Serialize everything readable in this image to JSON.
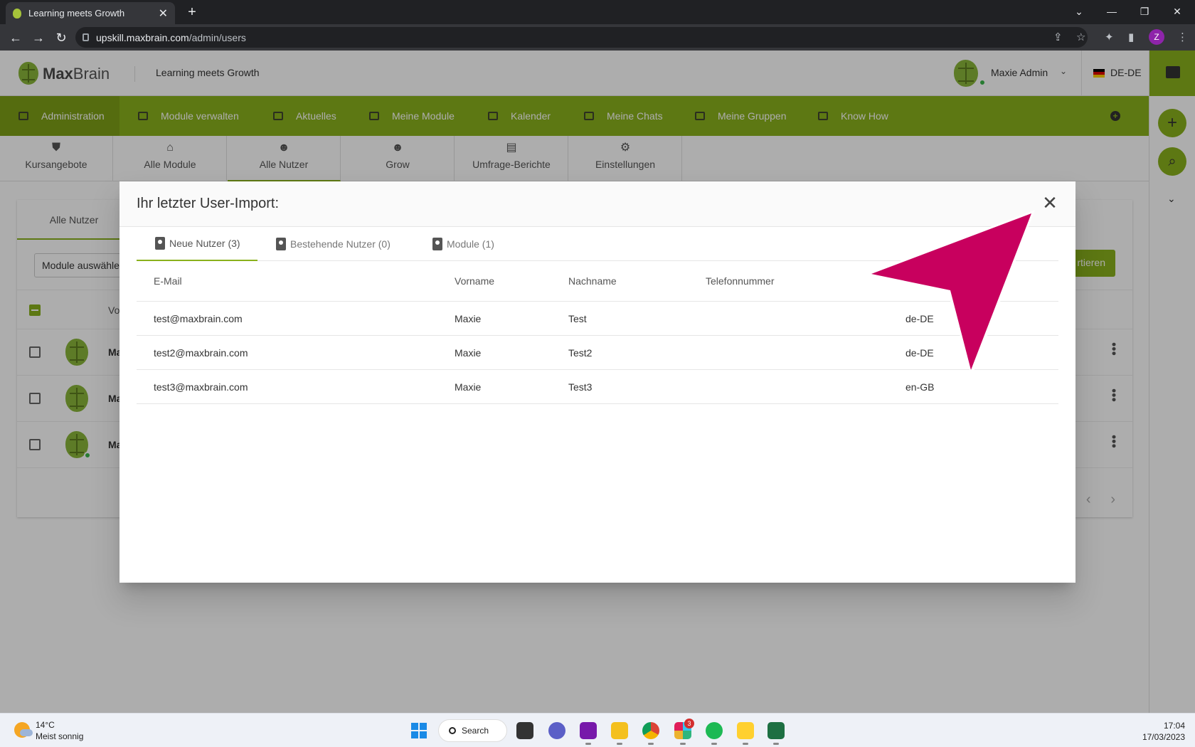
{
  "browser": {
    "tab_title": "Learning meets Growth",
    "url_host": "upskill.maxbrain.com",
    "url_path": "/admin/users",
    "profile_initial": "Z"
  },
  "header": {
    "logo_bold": "Max",
    "logo_light": "Brain",
    "tagline": "Learning meets Growth",
    "user_name": "Maxie Admin",
    "language": "DE-DE"
  },
  "main_nav": [
    {
      "label": "Administration",
      "icon": "dashboard-icon"
    },
    {
      "label": "Module verwalten",
      "icon": "folder-icon"
    },
    {
      "label": "Aktuelles",
      "icon": "news-icon"
    },
    {
      "label": "Meine Module",
      "icon": "school-icon"
    },
    {
      "label": "Kalender",
      "icon": "calendar-icon"
    },
    {
      "label": "Meine Chats",
      "icon": "chat-icon"
    },
    {
      "label": "Meine Gruppen",
      "icon": "group-folder-icon"
    },
    {
      "label": "Know How",
      "icon": "book-icon"
    }
  ],
  "sub_nav": [
    {
      "label": "Kursangebote",
      "icon": "courses-icon"
    },
    {
      "label": "Alle Module",
      "icon": "institution-icon"
    },
    {
      "label": "Alle Nutzer",
      "icon": "people-icon"
    },
    {
      "label": "Grow",
      "icon": "groups-icon"
    },
    {
      "label": "Umfrage-Berichte",
      "icon": "report-icon"
    },
    {
      "label": "Einstellungen",
      "icon": "settings-icon"
    }
  ],
  "users_card": {
    "tab_label": "Alle Nutzer",
    "module_select": "Module auswähle",
    "export_button": "rtieren",
    "header_label": "Vo",
    "row_names": [
      "Ma",
      "Ma",
      "Ma"
    ]
  },
  "modal": {
    "title": "Ihr letzter User-Import:",
    "tabs": [
      {
        "label": "Neue Nutzer (3)",
        "icon": "contact-badge-icon"
      },
      {
        "label": "Bestehende Nutzer (0)",
        "icon": "contact-badge-icon"
      },
      {
        "label": "Module (1)",
        "icon": "clipboard-icon"
      }
    ],
    "columns": [
      "E-Mail",
      "Vorname",
      "Nachname",
      "Telefonnummer",
      ""
    ],
    "rows": [
      {
        "email": "test@maxbrain.com",
        "first": "Maxie",
        "last": "Test",
        "phone": "",
        "locale": "de-DE"
      },
      {
        "email": "test2@maxbrain.com",
        "first": "Maxie",
        "last": "Test2",
        "phone": "",
        "locale": "de-DE"
      },
      {
        "email": "test3@maxbrain.com",
        "first": "Maxie",
        "last": "Test3",
        "phone": "",
        "locale": "en-GB"
      }
    ]
  },
  "taskbar": {
    "temperature": "14°C",
    "weather": "Meist sonnig",
    "search_label": "Search",
    "slack_badge": "3",
    "time": "17:04",
    "date": "17/03/2023"
  },
  "colors": {
    "brand_green": "#8ab11c",
    "annotation_arrow": "#c8005e"
  }
}
